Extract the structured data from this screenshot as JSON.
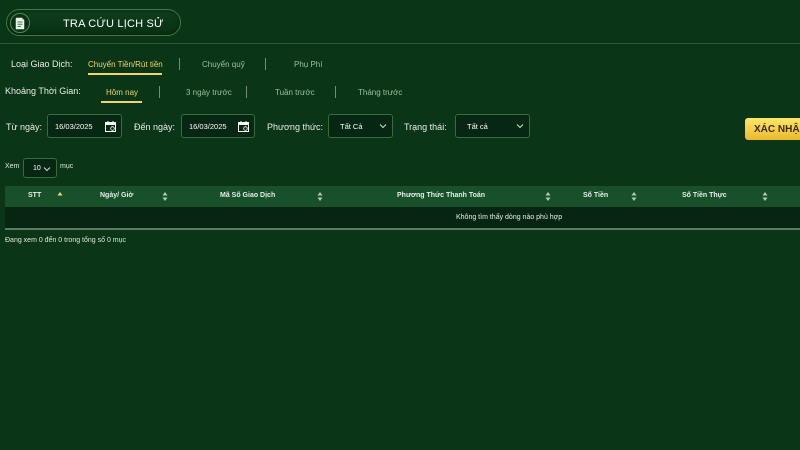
{
  "header": {
    "title": "TRA CỨU LỊCH SỬ",
    "icon": "document-icon"
  },
  "transaction_type": {
    "label": "Loại Giao Dịch:",
    "tabs": [
      {
        "label": "Chuyển Tiền/Rút tiền",
        "active": true
      },
      {
        "label": "Chuyển quỹ",
        "active": false
      },
      {
        "label": "Phụ Phí",
        "active": false
      }
    ]
  },
  "time_range": {
    "label": "Khoảng Thời Gian:",
    "tabs": [
      {
        "label": "Hôm nay",
        "active": true
      },
      {
        "label": "3 ngày trước",
        "active": false
      },
      {
        "label": "Tuần trước",
        "active": false
      },
      {
        "label": "Tháng trước",
        "active": false
      }
    ]
  },
  "filters": {
    "from_label": "Từ ngày:",
    "from_value": "16/03/2025",
    "to_label": "Đến ngày:",
    "to_value": "16/03/2025",
    "method_label": "Phương thức:",
    "method_value": "Tất Cả",
    "status_label": "Trạng thái:",
    "status_value": "Tất cả",
    "confirm_label": "XÁC NHẬN"
  },
  "page_size": {
    "prefix": "Xem",
    "value": "10",
    "suffix": "mục"
  },
  "table": {
    "columns": [
      "STT",
      "Ngày/ Giờ",
      "Mã Số Giao Dịch",
      "Phương Thức Thanh Toán",
      "Số Tiền",
      "Số Tiền Thực"
    ],
    "empty_message": "Không tìm thấy dòng nào phù hợp"
  },
  "footer_info": "Đang xem 0 đến 0 trong tổng số 0 mục",
  "colors": {
    "background": "#0a3517",
    "accent": "#f2d66a",
    "header_row": "#17502a",
    "button": "#f5d24a"
  }
}
